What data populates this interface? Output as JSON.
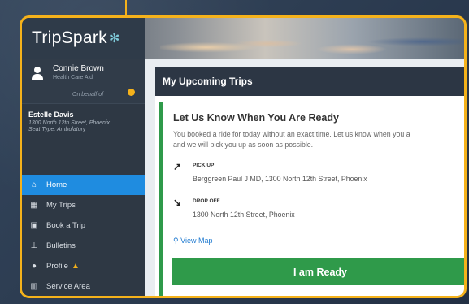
{
  "app": {
    "logo": "TripSpark",
    "logo_mark": "✻"
  },
  "user": {
    "name": "Connie Brown",
    "role": "Health Care Aid",
    "on_behalf": "On behalf of"
  },
  "client": {
    "name": "Estelle Davis",
    "address": "1300 North 12th Street, Phoenix",
    "seat_type": "Seat Type: Ambulatory"
  },
  "sidebar": {
    "items": [
      {
        "label": "Home",
        "icon": "home-icon",
        "active": true
      },
      {
        "label": "My Trips",
        "icon": "calendar-icon"
      },
      {
        "label": "Book a Trip",
        "icon": "bus-icon"
      },
      {
        "label": "Bulletins",
        "icon": "pin-icon"
      },
      {
        "label": "Profile",
        "icon": "user-icon",
        "warning": true
      },
      {
        "label": "Service Area",
        "icon": "map-icon"
      }
    ]
  },
  "main": {
    "title": "My Upcoming Trips",
    "card": {
      "title": "Let Us Know When You Are Ready",
      "desc_line1": "You booked a ride for today without an exact time. Let us know when you a",
      "desc_line2": "and we will pick you up as soon as possible.",
      "pickup_label": "PICK UP",
      "pickup_addr": "Berggreen Paul J MD, 1300 North 12th Street, Phoenix",
      "dropoff_label": "DROP OFF",
      "dropoff_addr": "1300 North 12th Street, Phoenix",
      "view_map": "View Map",
      "ready_button": "I am Ready"
    }
  },
  "colors": {
    "accent": "#f5b21b",
    "nav_active": "#1f8ce0",
    "success": "#2f9a4a",
    "link": "#1f7ad0"
  }
}
